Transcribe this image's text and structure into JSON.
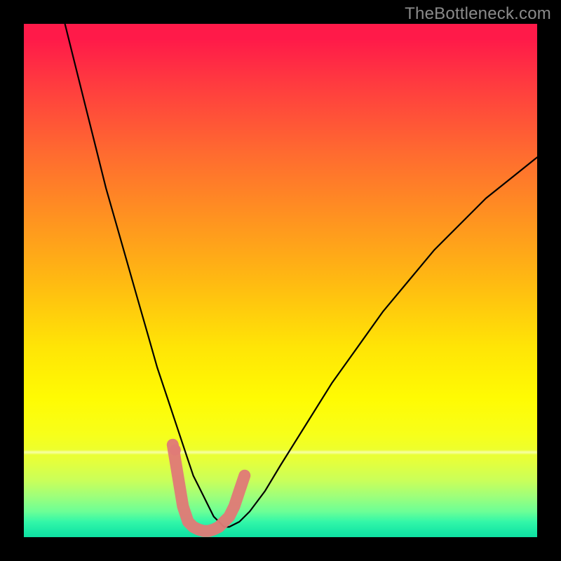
{
  "watermark": "TheBottleneck.com",
  "chart_data": {
    "type": "line",
    "title": "",
    "xlabel": "",
    "ylabel": "",
    "xlim": [
      0,
      100
    ],
    "ylim": [
      0,
      100
    ],
    "curve": {
      "x": [
        8,
        10,
        12,
        14,
        16,
        18,
        20,
        22,
        24,
        26,
        28,
        30,
        32,
        33,
        34,
        35,
        36,
        37,
        38,
        39,
        40,
        42,
        44,
        47,
        50,
        55,
        60,
        65,
        70,
        75,
        80,
        85,
        90,
        95,
        100
      ],
      "y": [
        100,
        92,
        84,
        76,
        68,
        61,
        54,
        47,
        40,
        33,
        27,
        21,
        15,
        12,
        10,
        8,
        6,
        4,
        3,
        2,
        2,
        3,
        5,
        9,
        14,
        22,
        30,
        37,
        44,
        50,
        56,
        61,
        66,
        70,
        74
      ]
    },
    "highlight": {
      "color": "#e07b77",
      "x": [
        29,
        30,
        31,
        32,
        33,
        34,
        35,
        36,
        37,
        38,
        39,
        40,
        41,
        42,
        43
      ],
      "y": [
        18,
        12,
        6,
        3,
        2,
        1.5,
        1.2,
        1.2,
        1.5,
        2,
        3,
        4,
        6,
        9,
        12
      ]
    },
    "highlight_dot": {
      "x": 29.5,
      "y": 17
    },
    "gradient_stops": [
      {
        "pos": 0,
        "color": "#ff1a49"
      },
      {
        "pos": 25,
        "color": "#ff6a30"
      },
      {
        "pos": 50,
        "color": "#ffb912"
      },
      {
        "pos": 73,
        "color": "#fffb03"
      },
      {
        "pos": 90,
        "color": "#9fff7a"
      },
      {
        "pos": 100,
        "color": "#0fe0a2"
      }
    ]
  }
}
